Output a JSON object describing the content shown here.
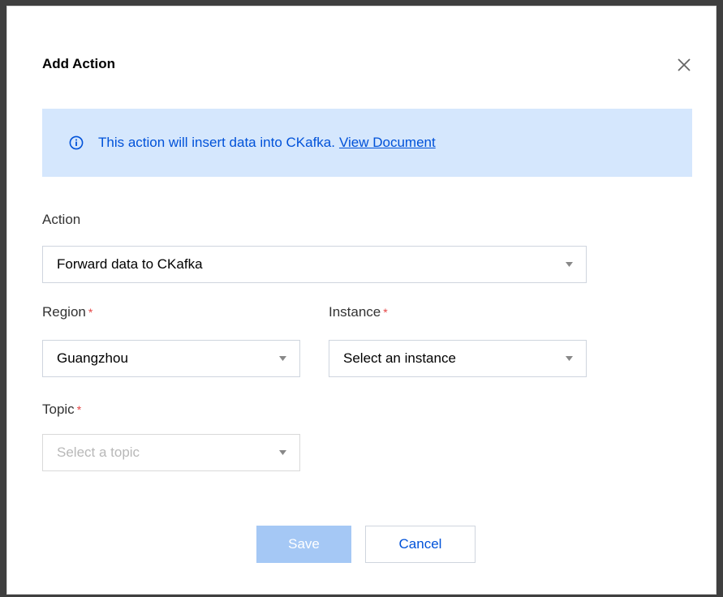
{
  "dialog": {
    "title": "Add Action",
    "close_icon": "close-icon"
  },
  "banner": {
    "icon": "info-icon",
    "text": "This action will insert data into CKafka.",
    "link_label": "View Document"
  },
  "form": {
    "action": {
      "label": "Action",
      "value": "Forward data to CKafka"
    },
    "region": {
      "label": "Region",
      "required_mark": "*",
      "value": "Guangzhou"
    },
    "instance": {
      "label": "Instance",
      "required_mark": "*",
      "value": "Select an instance"
    },
    "topic": {
      "label": "Topic",
      "required_mark": "*",
      "placeholder": "Select a topic"
    }
  },
  "buttons": {
    "save_label": "Save",
    "cancel_label": "Cancel"
  },
  "colors": {
    "accent": "#0052d9",
    "banner_bg": "#d5e7fd",
    "required": "#e54545",
    "save_disabled": "#a5c8f5"
  }
}
